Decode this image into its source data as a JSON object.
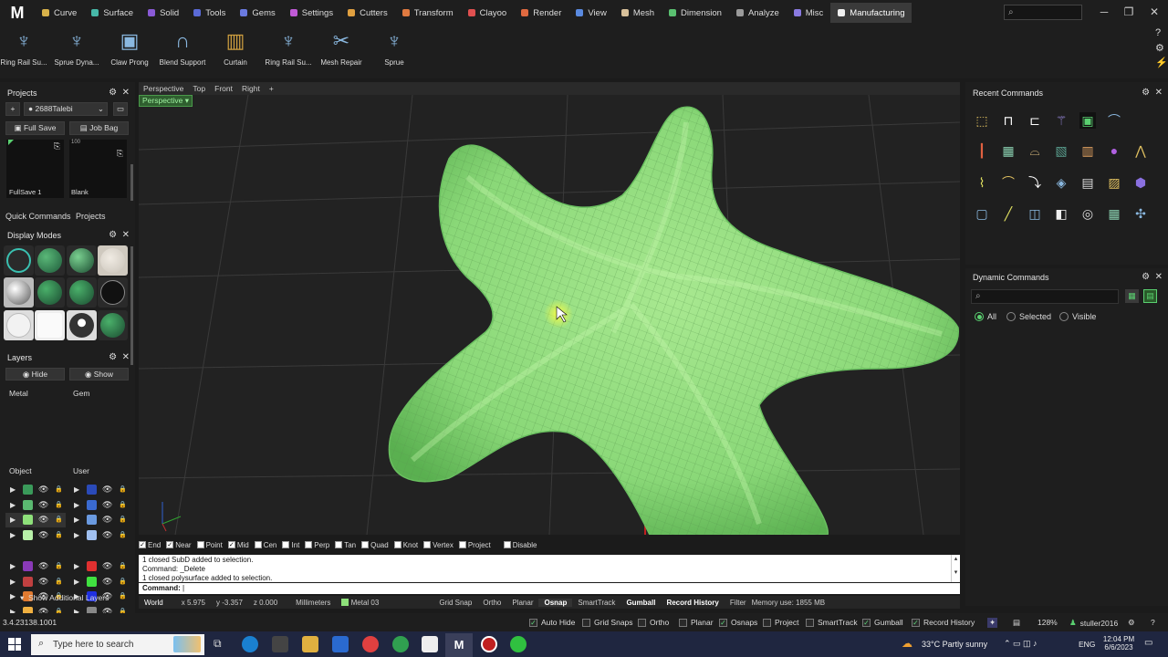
{
  "app": {
    "logo": "M"
  },
  "menu_tabs": [
    {
      "label": "Curve",
      "color": "#d8b24a"
    },
    {
      "label": "Surface",
      "color": "#47b8a8"
    },
    {
      "label": "Solid",
      "color": "#8a5ad6"
    },
    {
      "label": "Tools",
      "color": "#5a6ad6"
    },
    {
      "label": "Gems",
      "color": "#6a7ae0"
    },
    {
      "label": "Settings",
      "color": "#c05ad6"
    },
    {
      "label": "Cutters",
      "color": "#e0a040"
    },
    {
      "label": "Transform",
      "color": "#e07a40"
    },
    {
      "label": "Clayoo",
      "color": "#e05050"
    },
    {
      "label": "Render",
      "color": "#e06a40"
    },
    {
      "label": "View",
      "color": "#5a8ae0"
    },
    {
      "label": "Mesh",
      "color": "#d8c09a"
    },
    {
      "label": "Dimension",
      "color": "#5ac070"
    },
    {
      "label": "Analyze",
      "color": "#9a9a9a"
    },
    {
      "label": "Misc",
      "color": "#8a7ae0"
    },
    {
      "label": "Manufacturing",
      "color": "#f0f0f0"
    }
  ],
  "top_search": {
    "placeholder": "⌕"
  },
  "toolbar": [
    {
      "label": "Ring Rail Su...",
      "icon": "ring-rail-icon"
    },
    {
      "label": "Sprue Dyna...",
      "icon": "sprue-dynamic-icon"
    },
    {
      "label": "Claw Prong",
      "icon": "claw-prong-icon"
    },
    {
      "label": "Blend Support",
      "icon": "blend-support-icon"
    },
    {
      "label": "Curtain",
      "icon": "curtain-icon"
    },
    {
      "label": "Ring Rail Su...",
      "icon": "ring-rail-icon"
    },
    {
      "label": "Mesh Repair",
      "icon": "mesh-repair-icon"
    },
    {
      "label": "Sprue",
      "icon": "sprue-icon"
    }
  ],
  "projects": {
    "title": "Projects",
    "project_name": "2688Talebi",
    "full_save": "Full Save",
    "job_bag": "Job Bag",
    "thumb1": "FullSave 1",
    "thumb2_top": "100",
    "thumb2": "Blank",
    "tab_quick": "Quick Commands",
    "tab_projects": "Projects"
  },
  "display_modes": {
    "title": "Display Modes"
  },
  "layers": {
    "title": "Layers",
    "hide": "Hide",
    "show": "Show",
    "group1": "Metal",
    "group2": "Gem",
    "group3": "Object",
    "group4": "User",
    "metal_colors": [
      "#3a9a5a",
      "#5ab870",
      "#8ee07a",
      "#b8f0a8"
    ],
    "gem_colors": [
      "#2a4ab8",
      "#3a6ad0",
      "#6a9ae0",
      "#a0c0f0"
    ],
    "object_colors": [
      "#8a3ab8",
      "#c04040",
      "#e07a30",
      "#f0b040"
    ],
    "user_colors": [
      "#e03030",
      "#40e040",
      "#2030e0",
      "#888888"
    ],
    "additional": "Show Additional Layers"
  },
  "viewport": {
    "tabs": [
      "Perspective",
      "Top",
      "Front",
      "Right",
      "+"
    ],
    "active_label": "Perspective"
  },
  "osnap": {
    "items": [
      {
        "label": "End",
        "checked": true
      },
      {
        "label": "Near",
        "checked": true
      },
      {
        "label": "Point",
        "checked": false
      },
      {
        "label": "Mid",
        "checked": true
      },
      {
        "label": "Cen",
        "checked": false
      },
      {
        "label": "Int",
        "checked": false
      },
      {
        "label": "Perp",
        "checked": false
      },
      {
        "label": "Tan",
        "checked": false
      },
      {
        "label": "Quad",
        "checked": false
      },
      {
        "label": "Knot",
        "checked": false
      },
      {
        "label": "Vertex",
        "checked": false
      },
      {
        "label": "Project",
        "checked": false
      },
      {
        "label": "Disable",
        "checked": false
      }
    ]
  },
  "command": {
    "log1": "1 closed SubD added to selection.",
    "log2": "Command: _Delete",
    "log3": "1 closed polysurface added to selection.",
    "prompt": "Command:"
  },
  "status": {
    "world": "World",
    "x": "x 5.975",
    "y": "y -3.357",
    "z": "z 0.000",
    "units": "Millimeters",
    "layer": "Metal 03",
    "layer_color": "#8ee07a",
    "grid_snap": "Grid Snap",
    "ortho": "Ortho",
    "planar": "Planar",
    "osnap": "Osnap",
    "smarttrack": "SmartTrack",
    "gumball": "Gumball",
    "record_history": "Record History",
    "filter": "Filter",
    "memory": "Memory use: 1855 MB"
  },
  "recent_commands": {
    "title": "Recent Commands"
  },
  "dynamic_commands": {
    "title": "Dynamic Commands",
    "search_placeholder": "⌕",
    "all": "All",
    "selected": "Selected",
    "visible": "Visible"
  },
  "bottom": {
    "version": "3.4.23138.1001",
    "auto_hide": "Auto Hide",
    "grid_snaps": "Grid Snaps",
    "ortho": "Ortho",
    "planar": "Planar",
    "osnaps": "Osnaps",
    "project": "Project",
    "smarttrack": "SmartTrack",
    "gumball": "Gumball",
    "record_history": "Record History",
    "zoom": "128%",
    "user": "stuller2016"
  },
  "taskbar": {
    "search_placeholder": "Type here to search",
    "weather": "33°C  Partly sunny",
    "lang": "ENG",
    "time": "12:04 PM",
    "date": "6/6/2023"
  }
}
